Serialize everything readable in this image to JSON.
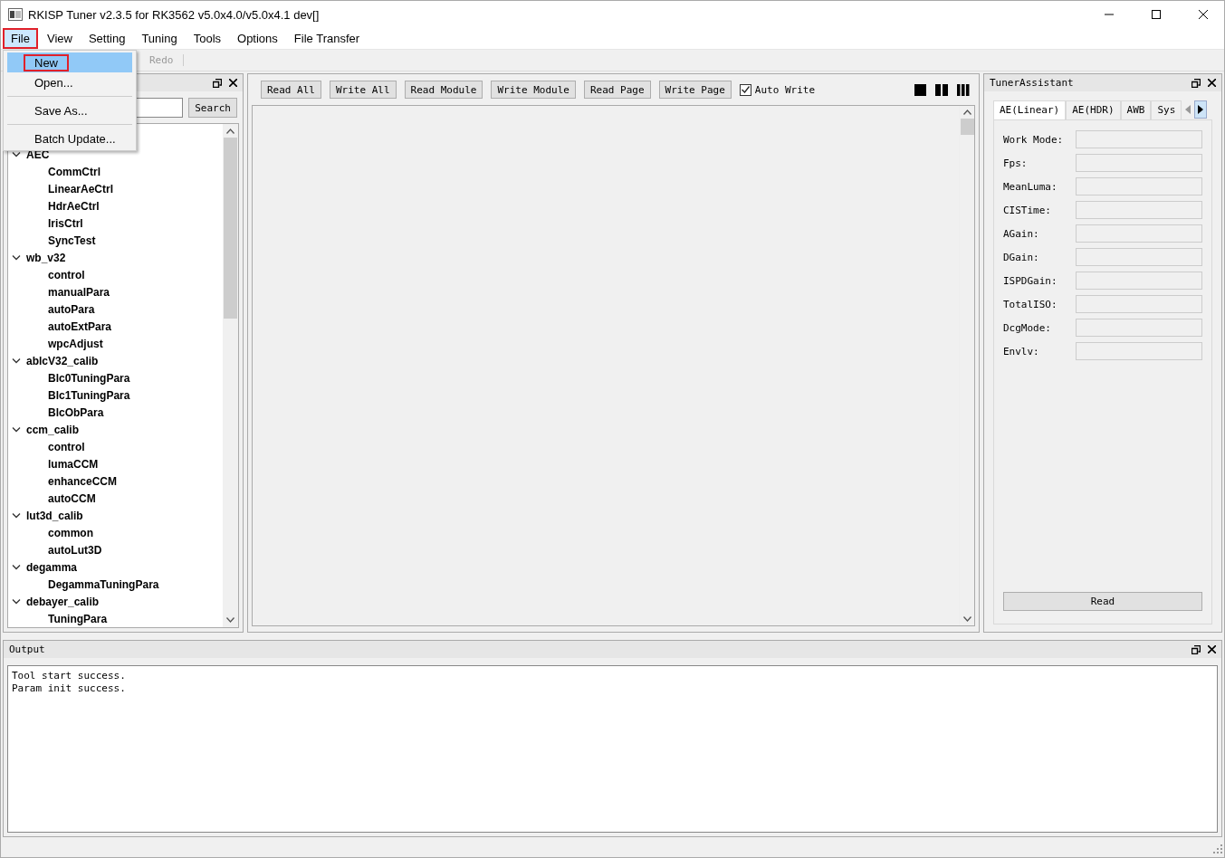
{
  "window": {
    "title": "RKISP Tuner v2.3.5 for RK3562 v5.0x4.0/v5.0x4.1 dev[]"
  },
  "menubar": [
    {
      "label": "File",
      "selected": true
    },
    {
      "label": "View",
      "selected": false
    },
    {
      "label": "Setting",
      "selected": false
    },
    {
      "label": "Tuning",
      "selected": false
    },
    {
      "label": "Tools",
      "selected": false
    },
    {
      "label": "Options",
      "selected": false
    },
    {
      "label": "File Transfer",
      "selected": false
    }
  ],
  "file_menu": [
    {
      "label": "New",
      "selected": true,
      "separator_before": false
    },
    {
      "label": "Open...",
      "selected": false,
      "separator_before": false
    },
    {
      "label": "Save As...",
      "selected": false,
      "separator_before": true
    },
    {
      "label": "Batch Update...",
      "selected": false,
      "separator_before": true
    }
  ],
  "toolbar": [
    {
      "label": "Redo",
      "disabled": true
    }
  ],
  "module_panel": {
    "search_button": "Search",
    "tree": [
      {
        "label": "AEC",
        "expanded": true,
        "children": [
          {
            "label": "CommCtrl"
          },
          {
            "label": "LinearAeCtrl"
          },
          {
            "label": "HdrAeCtrl"
          },
          {
            "label": "IrisCtrl"
          },
          {
            "label": "SyncTest"
          }
        ]
      },
      {
        "label": "wb_v32",
        "expanded": true,
        "children": [
          {
            "label": "control"
          },
          {
            "label": "manualPara"
          },
          {
            "label": "autoPara"
          },
          {
            "label": "autoExtPara"
          },
          {
            "label": "wpcAdjust"
          }
        ]
      },
      {
        "label": "ablcV32_calib",
        "expanded": true,
        "children": [
          {
            "label": "Blc0TuningPara"
          },
          {
            "label": "Blc1TuningPara"
          },
          {
            "label": "BlcObPara"
          }
        ]
      },
      {
        "label": "ccm_calib",
        "expanded": true,
        "children": [
          {
            "label": "control"
          },
          {
            "label": "lumaCCM"
          },
          {
            "label": "enhanceCCM"
          },
          {
            "label": "autoCCM"
          }
        ]
      },
      {
        "label": "lut3d_calib",
        "expanded": true,
        "children": [
          {
            "label": "common"
          },
          {
            "label": "autoLut3D"
          }
        ]
      },
      {
        "label": "degamma",
        "expanded": true,
        "children": [
          {
            "label": "DegammaTuningPara"
          }
        ]
      },
      {
        "label": "debayer_calib",
        "expanded": true,
        "children": [
          {
            "label": "TuningPara"
          }
        ]
      }
    ]
  },
  "center": {
    "buttons": [
      "Read All",
      "Write All",
      "Read Module",
      "Write Module",
      "Read Page",
      "Write Page"
    ],
    "auto_write": {
      "label": "Auto Write",
      "checked": true
    }
  },
  "tuner_assistant": {
    "title": "TunerAssistant",
    "tabs": [
      {
        "label": "AE(Linear)",
        "selected": true
      },
      {
        "label": "AE(HDR)",
        "selected": false
      },
      {
        "label": "AWB",
        "selected": false
      },
      {
        "label": "Sys",
        "selected": false
      }
    ],
    "fields": [
      {
        "label": "Work Mode:"
      },
      {
        "label": "Fps:"
      },
      {
        "label": "MeanLuma:"
      },
      {
        "label": "CISTime:"
      },
      {
        "label": "AGain:"
      },
      {
        "label": "DGain:"
      },
      {
        "label": "ISPDGain:"
      },
      {
        "label": "TotalISO:"
      },
      {
        "label": "DcgMode:"
      },
      {
        "label": "Envlv:"
      }
    ],
    "read_button": "Read"
  },
  "output": {
    "title": "Output",
    "lines": [
      "Tool start success.",
      "Param init success."
    ]
  }
}
